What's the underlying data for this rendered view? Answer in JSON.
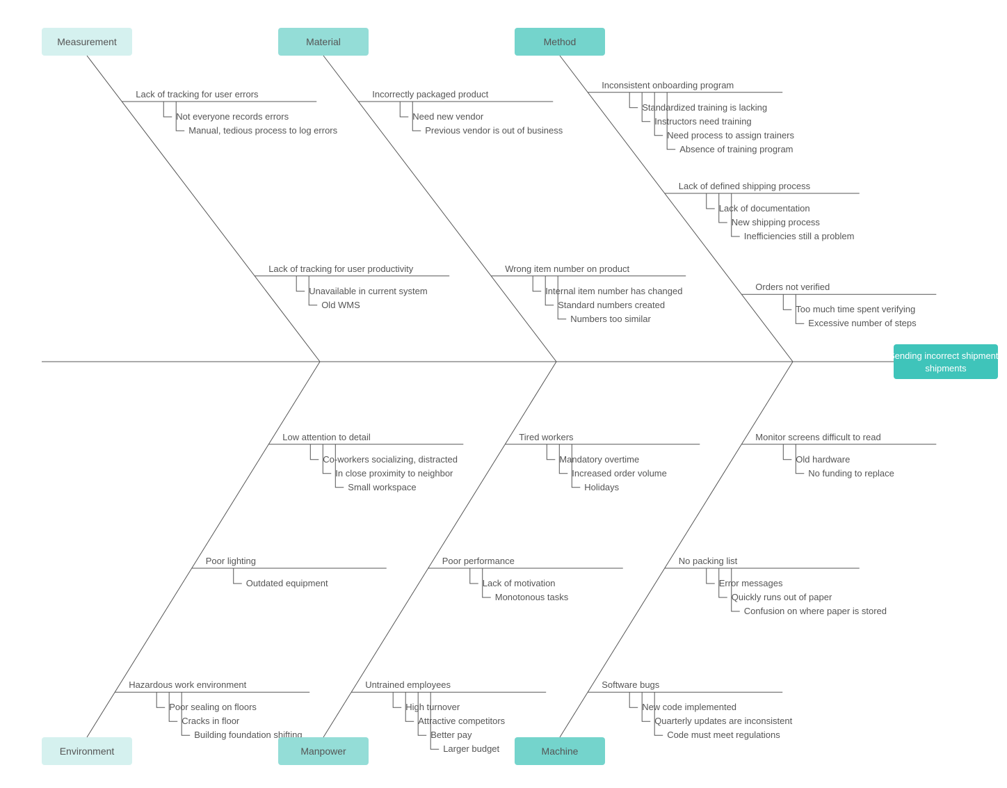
{
  "chart_data": {
    "type": "fishbone",
    "effect": "Sending incorrect shipments",
    "top_categories": [
      {
        "name": "Measurement",
        "color": "#d5f1ef",
        "causes": [
          {
            "label": "Lack of tracking for user errors",
            "subs": [
              "Not everyone records errors",
              "Manual, tedious process to log errors"
            ]
          },
          {
            "label": "Lack of tracking for user productivity",
            "subs": [
              "Unavailable in current system",
              "Old WMS"
            ]
          }
        ]
      },
      {
        "name": "Material",
        "color": "#94ddd7",
        "causes": [
          {
            "label": "Incorrectly packaged product",
            "subs": [
              "Need new vendor",
              "Previous vendor is out of business"
            ]
          },
          {
            "label": "Wrong item number on product",
            "subs": [
              "Internal item number has changed",
              "Standard numbers created",
              "Numbers too similar"
            ]
          }
        ]
      },
      {
        "name": "Method",
        "color": "#74d4cc",
        "causes": [
          {
            "label": "Inconsistent onboarding program",
            "subs": [
              "Standardized training is lacking",
              "Instructors need training",
              "Need process to assign trainers",
              "Absence of training program"
            ]
          },
          {
            "label": "Lack of defined shipping process",
            "subs": [
              "Lack of documentation",
              "New shipping process",
              "Inefficiencies still a problem"
            ]
          },
          {
            "label": "Orders not verified",
            "subs": [
              "Too much time spent verifying",
              "Excessive number of steps"
            ]
          }
        ]
      }
    ],
    "bottom_categories": [
      {
        "name": "Environment",
        "color": "#d5f1ef",
        "causes": [
          {
            "label": "Hazardous work environment",
            "subs": [
              "Poor sealing on floors",
              "Cracks in floor",
              "Building foundation shifting"
            ]
          },
          {
            "label": "Poor lighting",
            "subs": [
              "Outdated equipment"
            ]
          },
          {
            "label": "Low attention to detail",
            "subs": [
              "Co-workers socializing, distracted",
              "In close proximity to neighbor",
              "Small workspace"
            ]
          }
        ]
      },
      {
        "name": "Manpower",
        "color": "#94ddd7",
        "causes": [
          {
            "label": "Untrained employees",
            "subs": [
              "High turnover",
              "Attractive competitors",
              "Better pay",
              "Larger budget"
            ]
          },
          {
            "label": "Poor performance",
            "subs": [
              "Lack of motivation",
              "Monotonous tasks"
            ]
          },
          {
            "label": "Tired workers",
            "subs": [
              "Mandatory overtime",
              "Increased order volume",
              "Holidays"
            ]
          }
        ]
      },
      {
        "name": "Machine",
        "color": "#74d4cc",
        "causes": [
          {
            "label": "Software bugs",
            "subs": [
              "New code implemented",
              "Quarterly updates are inconsistent",
              "Code must meet regulations"
            ]
          },
          {
            "label": "No packing list",
            "subs": [
              "Error messages",
              "Quickly runs out of paper",
              "Confusion on where paper is stored"
            ]
          },
          {
            "label": "Monitor screens difficult to read",
            "subs": [
              "Old hardware",
              "No funding to replace"
            ]
          }
        ]
      }
    ]
  }
}
